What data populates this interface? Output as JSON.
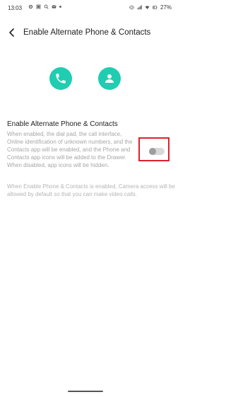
{
  "status_bar": {
    "time": "13:03",
    "battery": "27%"
  },
  "header": {
    "title": "Enable Alternate Phone & Contacts"
  },
  "colors": {
    "accent": "#1fcdb0",
    "highlight": "#e0202d"
  },
  "setting": {
    "title": "Enable Alternate Phone & Contacts",
    "description": "When enabled, the dial pad, the call interface, Online identification of unknown numbers, and the Contacts app will be enabled, and the Phone and Contacts app icons will be added to the Drawer. When disabled, app icons will be hidden.",
    "enabled": false
  },
  "footnote": "When Enable Phone & Contacts is enabled, Camera access will be allowed by default so that you can make video calls."
}
